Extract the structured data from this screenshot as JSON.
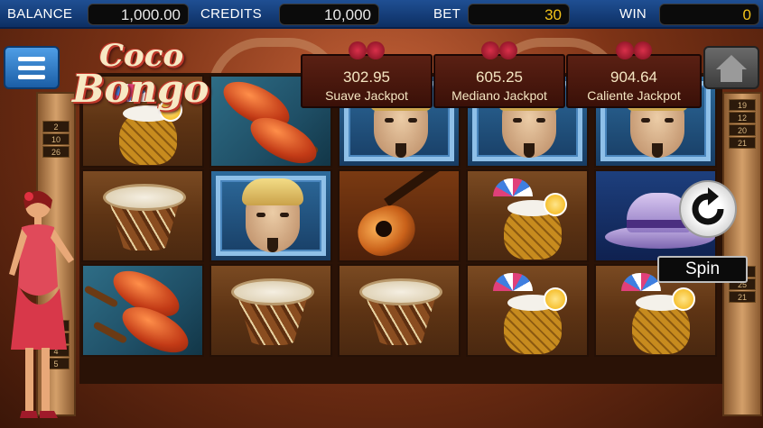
{
  "status_bar": {
    "balance_label": "BALANCE",
    "balance_value": "1,000.00",
    "credits_label": "CREDITS",
    "credits_value": "10,000",
    "bet_label": "BET",
    "bet_value": "30",
    "win_label": "WIN",
    "win_value": "0"
  },
  "logo": {
    "line1": "Coco",
    "line2": "Bongo"
  },
  "jackpots": [
    {
      "value": "302.95",
      "label": "Suave Jackpot"
    },
    {
      "value": "605.25",
      "label": "Mediano Jackpot"
    },
    {
      "value": "904.64",
      "label": "Caliente Jackpot"
    }
  ],
  "spin": {
    "label": "Spin",
    "icon": "refresh-icon"
  },
  "buttons": {
    "menu_icon": "hamburger-menu-icon",
    "home_icon": "home-icon"
  },
  "paylines": {
    "left": [
      "2",
      "10",
      "26",
      "1",
      "3",
      "4",
      "5"
    ],
    "right": [
      "19",
      "12",
      "20",
      "21",
      "17",
      "25",
      "21"
    ]
  },
  "reels": [
    [
      "cocktail",
      "drum",
      "maracas"
    ],
    [
      "maracas",
      "man",
      "drum"
    ],
    [
      "man",
      "guitar",
      "drum"
    ],
    [
      "man",
      "cocktail",
      "cocktail"
    ],
    [
      "man",
      "hat",
      "cocktail"
    ]
  ],
  "colors": {
    "bar": "#1f4f93",
    "win_text": "#f2c21a",
    "jackpot_bg": "#5a2013"
  }
}
